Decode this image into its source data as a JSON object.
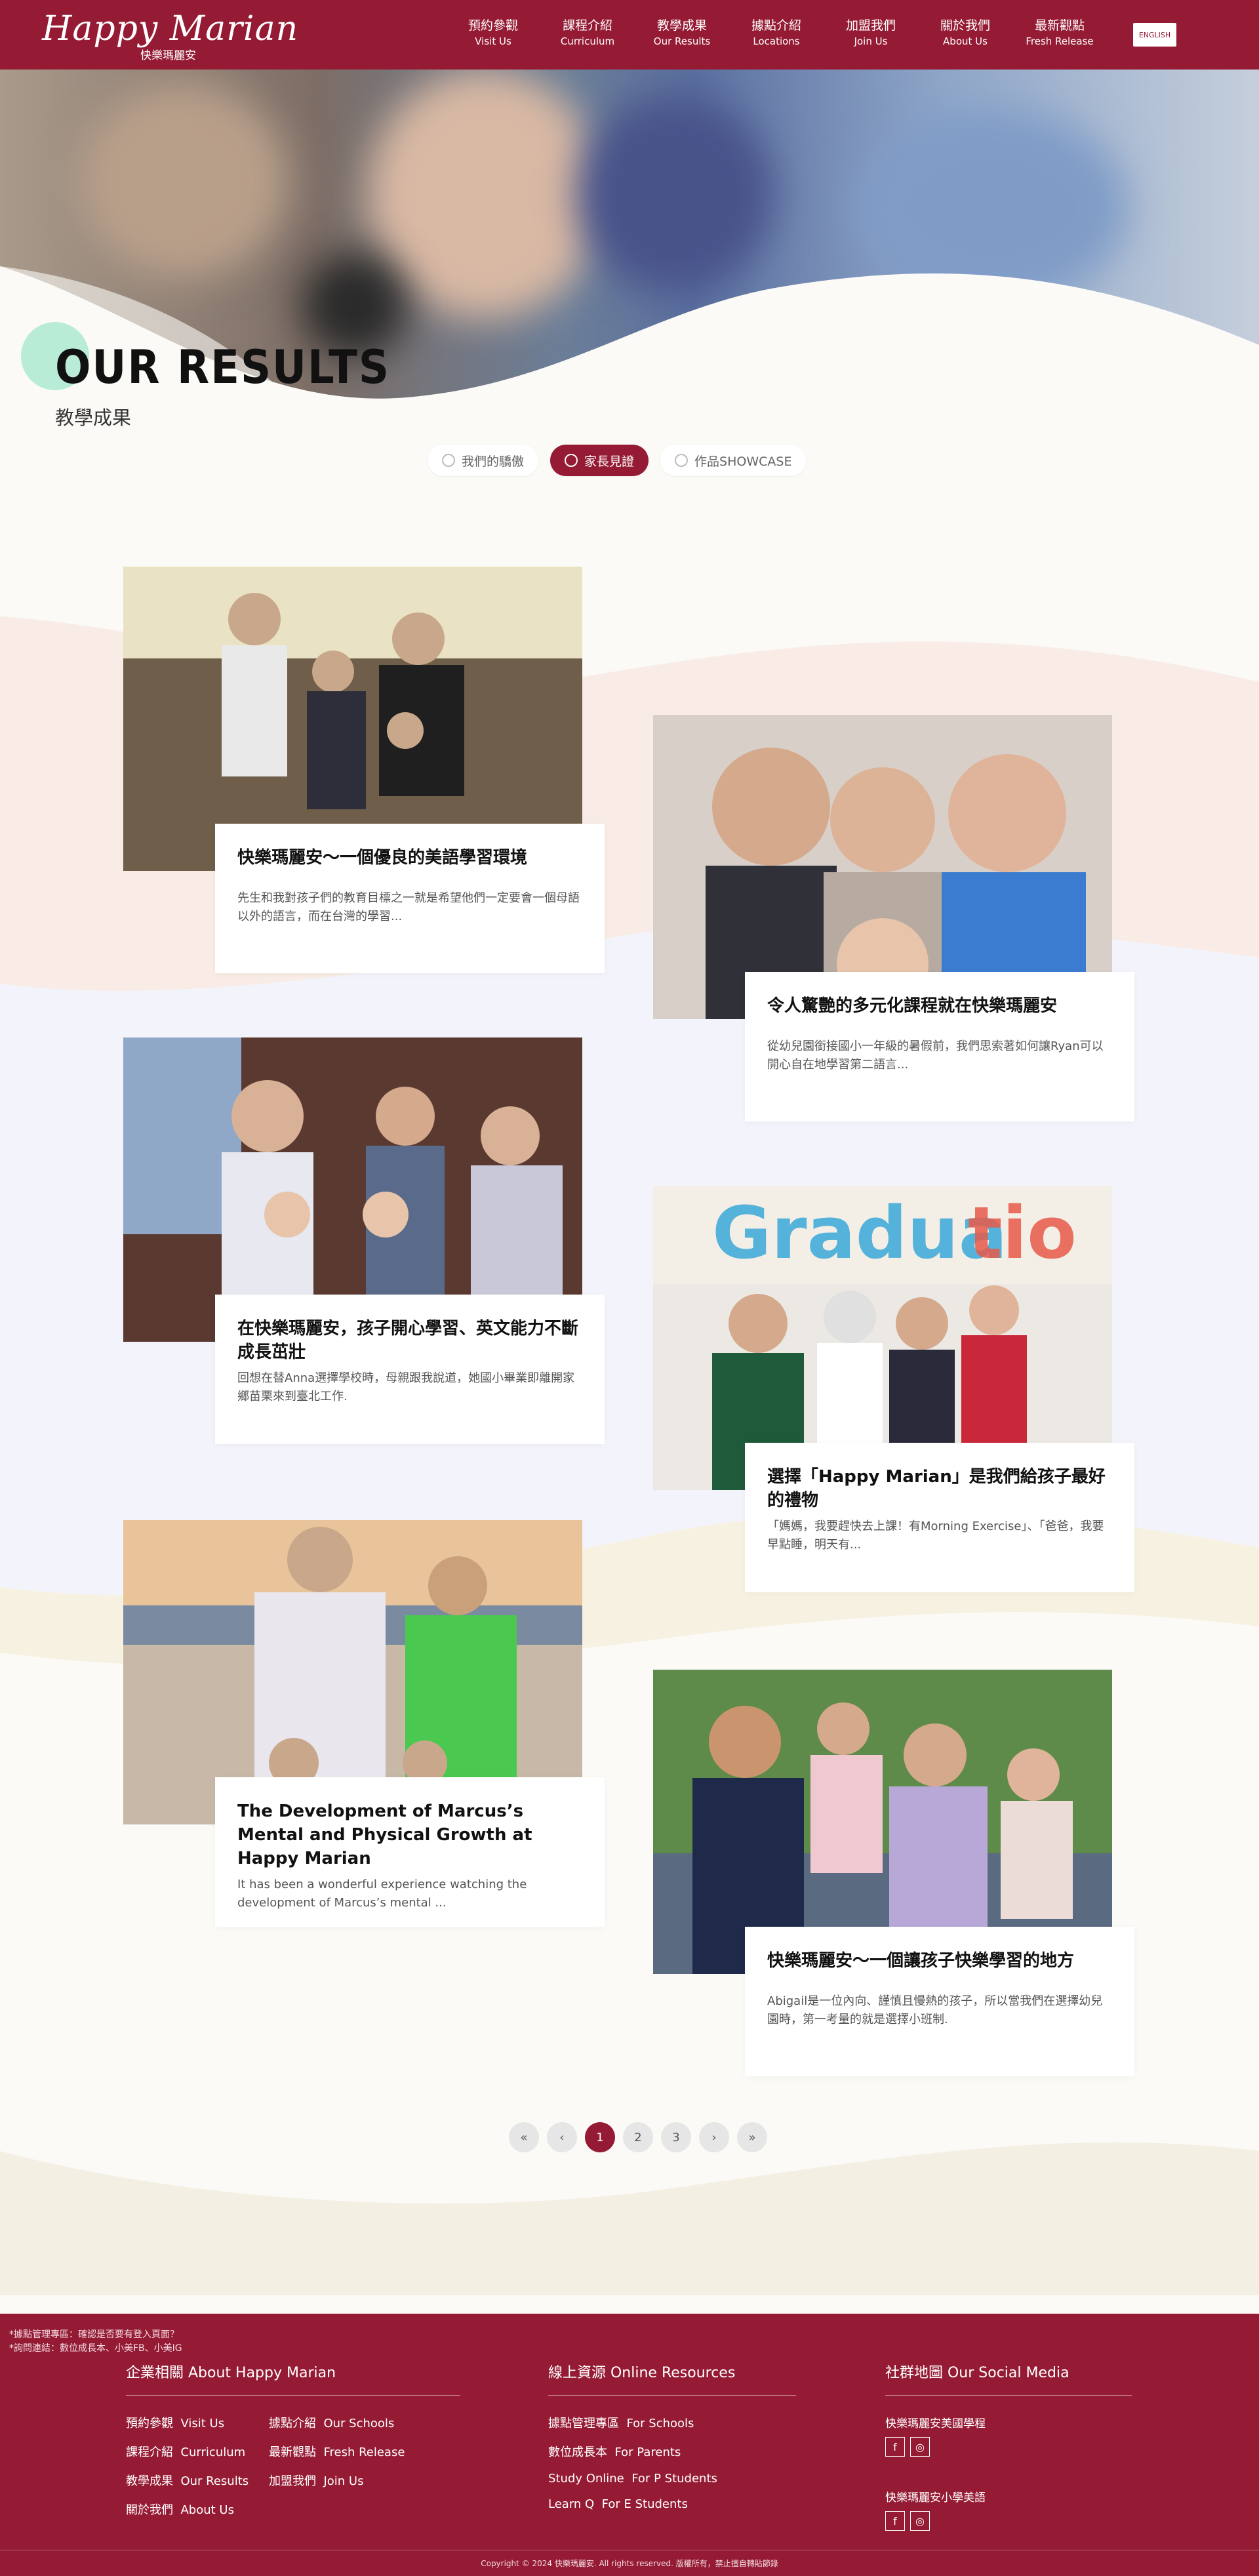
{
  "header": {
    "logo_text": "Happy Marian",
    "logo_sub": "快樂瑪麗安",
    "nav": [
      {
        "zh": "預約參觀",
        "en": "Visit Us"
      },
      {
        "zh": "課程介紹",
        "en": "Curriculum"
      },
      {
        "zh": "教學成果",
        "en": "Our Results"
      },
      {
        "zh": "據點介紹",
        "en": "Locations"
      },
      {
        "zh": "加盟我們",
        "en": "Join Us"
      },
      {
        "zh": "關於我們",
        "en": "About Us"
      },
      {
        "zh": "最新觀點",
        "en": "Fresh Release"
      }
    ],
    "lang_button": "ENGLISH"
  },
  "hero": {
    "title": "OUR RESULTS",
    "subtitle": "教學成果"
  },
  "tabs": [
    {
      "label": "我們的驕傲",
      "icon": "people-icon"
    },
    {
      "label": "家長見證",
      "icon": "thumbs-up-icon",
      "active": true
    },
    {
      "label": "作品SHOWCASE",
      "icon": "trophy-icon"
    }
  ],
  "cards": [
    {
      "title": "快樂瑪麗安～一個優良的美語學習環境",
      "desc": "先生和我對孩子們的教育目標之一就是希望他們一定要會一個母語以外的語言，而在台灣的學習..."
    },
    {
      "title": "令人驚艷的多元化課程就在快樂瑪麗安",
      "desc": "從幼兒園銜接國小一年級的暑假前，我們思索著如何讓Ryan可以開心自在地學習第二語言..."
    },
    {
      "title": "在快樂瑪麗安，孩子開心學習、英文能力不斷成長茁壯",
      "desc": "回想在替Anna選擇學校時，母親跟我說道，她國小畢業即離開家鄉苗栗來到臺北工作."
    },
    {
      "title": "選擇「Happy Marian」是我們給孩子最好的禮物",
      "desc": "「媽媽，我要趕快去上課！有Morning Exercise」、「爸爸，我要早點睡，明天有..."
    },
    {
      "title": "The Development of Marcus’s Mental and Physical Growth at Happy Marian",
      "desc": "It has been a wonderful experience watching the development of Marcus’s mental ..."
    },
    {
      "title": "快樂瑪麗安～一個讓孩子快樂學習的地方",
      "desc": "Abigail是一位內向、謹慎且慢熱的孩子，所以當我們在選擇幼兒園時，第一考量的就是選擇小班制."
    }
  ],
  "pagination": {
    "pages": [
      "1",
      "2",
      "3"
    ],
    "current": "1",
    "first": "«",
    "prev": "‹",
    "next": "›",
    "last": "»"
  },
  "footer": {
    "note_lines": [
      "*據點管理專區：確認是否要有登入頁面？",
      "*詢問連結：數位成長本、小美FB、小美IG"
    ],
    "about_heading": "企業相關 About Happy Marian",
    "about_links": [
      {
        "zh": "預約參觀",
        "en": "Visit Us"
      },
      {
        "zh": "據點介紹",
        "en": "Our Schools"
      },
      {
        "zh": "課程介紹",
        "en": "Curriculum"
      },
      {
        "zh": "最新觀點",
        "en": "Fresh Release"
      },
      {
        "zh": "教學成果",
        "en": "Our Results"
      },
      {
        "zh": "加盟我們",
        "en": "Join Us"
      },
      {
        "zh": "關於我們",
        "en": "About Us"
      }
    ],
    "resources_heading": "線上資源 Online Resources",
    "resource_links": [
      {
        "zh": "據點管理專區",
        "en": "For Schools"
      },
      {
        "zh": "數位成長本",
        "en": "For Parents"
      },
      {
        "zh": "Study Online",
        "en": "For P Students"
      },
      {
        "zh": "Learn Q",
        "en": "For E Students"
      }
    ],
    "social_heading": "社群地圖 Our Social Media",
    "social_groups": [
      {
        "name": "快樂瑪麗安美國學程"
      },
      {
        "name": "快樂瑪麗安小學美語"
      }
    ],
    "social_fb": "f",
    "social_ig": "◎",
    "copyright": "Copyright © 2024 快樂瑪麗安. All rights reserved. 版權所有，禁止擅自轉貼節錄"
  }
}
